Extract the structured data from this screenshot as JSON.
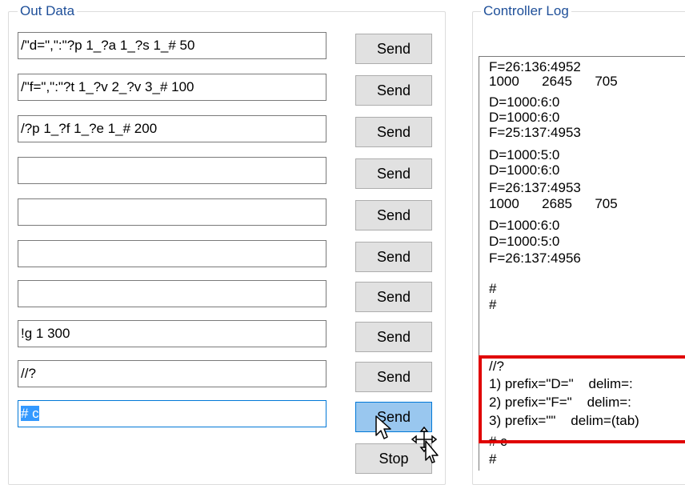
{
  "out_data": {
    "title": "Out Data",
    "rows": [
      {
        "value": "/\"d=\",\":\"?p 1_?a 1_?s 1_# 50",
        "button": "Send"
      },
      {
        "value": "/\"f=\",\":\"?t 1_?v 2_?v 3_# 100",
        "button": "Send"
      },
      {
        "value": "/?p 1_?f 1_?e 1_# 200",
        "button": "Send"
      },
      {
        "value": "",
        "button": "Send"
      },
      {
        "value": "",
        "button": "Send"
      },
      {
        "value": "",
        "button": "Send"
      },
      {
        "value": "",
        "button": "Send"
      },
      {
        "value": "!g 1 300",
        "button": "Send"
      },
      {
        "value": "//?",
        "button": "Send"
      },
      {
        "value": "# c",
        "button": "Send"
      }
    ],
    "stop_label": "Stop"
  },
  "controller_log": {
    "title": "Controller Log",
    "lines": [
      "F=26:136:4952",
      "1000      2645      705",
      "D=1000:6:0",
      "D=1000:6:0",
      "F=25:137:4953",
      "D=1000:5:0",
      "D=1000:6:0",
      "F=26:137:4953",
      "1000      2685      705",
      "D=1000:6:0",
      "D=1000:5:0",
      "F=26:137:4956",
      "#",
      "#",
      "//?",
      "1) prefix=\"D=\"    delim=:",
      "2) prefix=\"F=\"    delim=:",
      "3) prefix=\"\"    delim=(tab)",
      "# c",
      "#"
    ]
  },
  "colors": {
    "group_title": "#1e4f99",
    "selection": "#3399ff",
    "highlight": "#e00000",
    "button_pressed": "#99c7ef"
  }
}
